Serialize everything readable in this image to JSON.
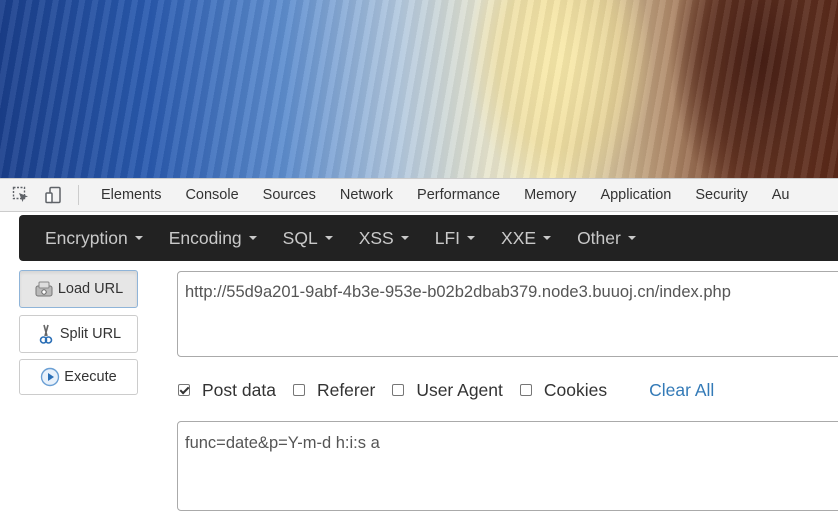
{
  "devtools": {
    "tabs": [
      "Elements",
      "Console",
      "Sources",
      "Network",
      "Performance",
      "Memory",
      "Application",
      "Security",
      "Au"
    ]
  },
  "hackbar": {
    "menu": [
      "Encryption",
      "Encoding",
      "SQL",
      "XSS",
      "LFI",
      "XXE",
      "Other"
    ],
    "buttons": {
      "load_url": "Load URL",
      "split_url": "Split URL",
      "execute": "Execute"
    },
    "url_value": "http://55d9a201-9abf-4b3e-953e-b02b2dbab379.node3.buuoj.cn/index.php",
    "options": {
      "post_data": "Post data",
      "referer": "Referer",
      "user_agent": "User Agent",
      "cookies": "Cookies",
      "post_data_checked": true,
      "referer_checked": false,
      "user_agent_checked": false,
      "cookies_checked": false
    },
    "clear_all": "Clear All",
    "post_value": "func=date&p=Y-m-d h:i:s a"
  },
  "colors": {
    "menu_bg": "#222222",
    "menu_text": "#c9c9c9",
    "link": "#337ab7"
  },
  "icons": {
    "inspect": "inspect-element-icon",
    "device": "device-toolbar-icon",
    "load": "load-url-icon",
    "split": "scissors-icon",
    "execute": "play-icon"
  }
}
